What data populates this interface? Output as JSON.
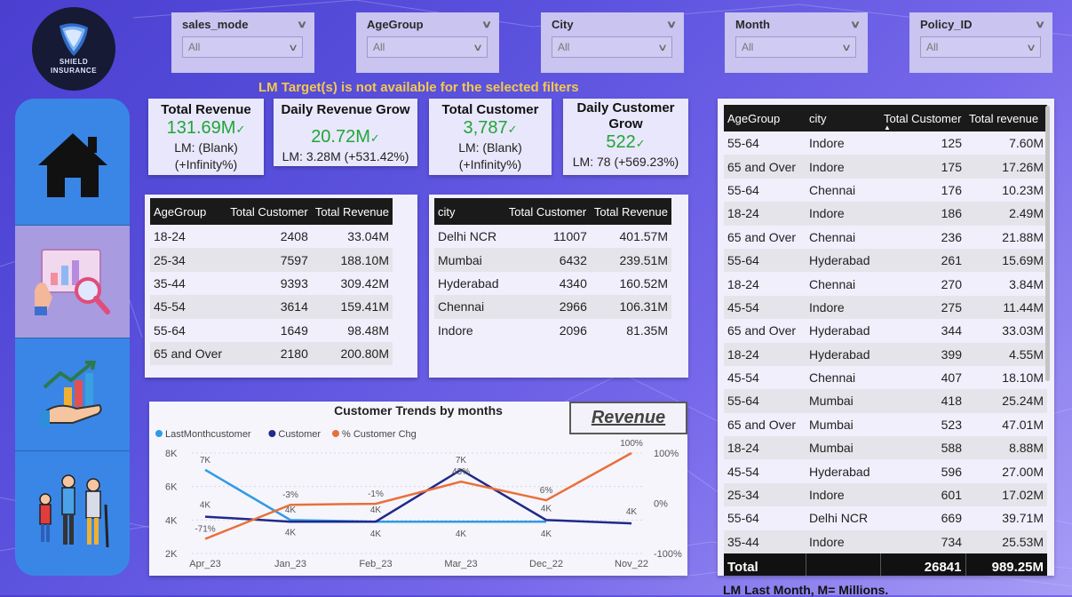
{
  "logo": {
    "name_line1": "SHIELD",
    "name_line2": "INSURANCE"
  },
  "nav": [
    {
      "name": "home-icon"
    },
    {
      "name": "analysis-icon"
    },
    {
      "name": "growth-icon"
    },
    {
      "name": "age-group-icon"
    }
  ],
  "slicers": [
    {
      "title": "sales_mode",
      "value": "All"
    },
    {
      "title": "AgeGroup",
      "value": "All"
    },
    {
      "title": "City",
      "value": "All"
    },
    {
      "title": "Month",
      "value": "All"
    },
    {
      "title": "Policy_ID",
      "value": "All"
    }
  ],
  "banner": "LM Target(s) is not available for the selected filters",
  "kpis": [
    {
      "title": "Total Revenue",
      "value": "131.69M",
      "lm": "LM: (Blank)",
      "chg": "(+Infinity%)"
    },
    {
      "title": "Daily Revenue Grow",
      "value": "20.72M",
      "lm": "LM: 3.28M (+531.42%)"
    },
    {
      "title": "Total Customer",
      "value": "3,787",
      "lm": "LM: (Blank)",
      "chg": "(+Infinity%)"
    },
    {
      "title1": "Daily Customer",
      "title2": "Grow",
      "value": "522",
      "lm": "LM: 78 (+569.23%)"
    }
  ],
  "age_table": {
    "headers": [
      "AgeGroup",
      "Total Customer",
      "Total Revenue"
    ],
    "rows": [
      [
        "18-24",
        "2408",
        "33.04M"
      ],
      [
        "25-34",
        "7597",
        "188.10M"
      ],
      [
        "35-44",
        "9393",
        "309.42M"
      ],
      [
        "45-54",
        "3614",
        "159.41M"
      ],
      [
        "55-64",
        "1649",
        "98.48M"
      ],
      [
        "65 and Over",
        "2180",
        "200.80M"
      ]
    ]
  },
  "city_table": {
    "headers": [
      "city",
      "Total Customer",
      "Total Revenue"
    ],
    "rows": [
      [
        "Delhi NCR",
        "11007",
        "401.57M"
      ],
      [
        "Mumbai",
        "6432",
        "239.51M"
      ],
      [
        "Hyderabad",
        "4340",
        "160.52M"
      ],
      [
        "Chennai",
        "2966",
        "106.31M"
      ],
      [
        "Indore",
        "2096",
        "81.35M"
      ]
    ]
  },
  "detail_table": {
    "headers": [
      "AgeGroup",
      "city",
      "Total Customer",
      "Total revenue"
    ],
    "rows": [
      [
        "55-64",
        "Indore",
        "125",
        "7.60M"
      ],
      [
        "65 and Over",
        "Indore",
        "175",
        "17.26M"
      ],
      [
        "55-64",
        "Chennai",
        "176",
        "10.23M"
      ],
      [
        "18-24",
        "Indore",
        "186",
        "2.49M"
      ],
      [
        "65 and Over",
        "Chennai",
        "236",
        "21.88M"
      ],
      [
        "55-64",
        "Hyderabad",
        "261",
        "15.69M"
      ],
      [
        "18-24",
        "Chennai",
        "270",
        "3.84M"
      ],
      [
        "45-54",
        "Indore",
        "275",
        "11.44M"
      ],
      [
        "65 and Over",
        "Hyderabad",
        "344",
        "33.03M"
      ],
      [
        "18-24",
        "Hyderabad",
        "399",
        "4.55M"
      ],
      [
        "45-54",
        "Chennai",
        "407",
        "18.10M"
      ],
      [
        "55-64",
        "Mumbai",
        "418",
        "25.24M"
      ],
      [
        "65 and Over",
        "Mumbai",
        "523",
        "47.01M"
      ],
      [
        "18-24",
        "Mumbai",
        "588",
        "8.88M"
      ],
      [
        "45-54",
        "Hyderabad",
        "596",
        "27.00M"
      ],
      [
        "25-34",
        "Indore",
        "601",
        "17.02M"
      ],
      [
        "55-64",
        "Delhi NCR",
        "669",
        "39.71M"
      ],
      [
        "35-44",
        "Indore",
        "734",
        "25.53M"
      ]
    ],
    "total": [
      "Total",
      "",
      "26841",
      "989.25M"
    ]
  },
  "revenue_button": "Revenue",
  "footnote": "LM Last Month, M= Millions.",
  "chart_data": {
    "type": "line",
    "title": "Customer Trends by months",
    "categories": [
      "Apr_23",
      "Jan_23",
      "Feb_23",
      "Mar_23",
      "Dec_22",
      "Nov_22"
    ],
    "y_left": {
      "ticks": [
        "2K",
        "4K",
        "6K",
        "8K"
      ],
      "min": 2000,
      "max": 8000
    },
    "y_right": {
      "ticks": [
        "-100%",
        "0%",
        "100%"
      ],
      "min": -100,
      "max": 100
    },
    "series": [
      {
        "name": "LastMonthcustomer",
        "color": "#2e9be6",
        "axis": "left",
        "values": [
          7000,
          4000,
          3900,
          3900,
          3900,
          null
        ],
        "labels": [
          "7K",
          "4K",
          "4K",
          "4K",
          "4K",
          ""
        ]
      },
      {
        "name": "Customer",
        "color": "#1f2a8a",
        "axis": "left",
        "values": [
          4200,
          3900,
          3900,
          7000,
          4000,
          3800
        ],
        "labels": [
          "4K",
          "4K",
          "4K",
          "7K",
          "4K",
          "4K"
        ]
      },
      {
        "name": "% Customer Chg",
        "color": "#e8703a",
        "axis": "right",
        "values": [
          -71,
          -3,
          -1,
          43,
          6,
          100
        ],
        "labels": [
          "-71%",
          "-3%",
          "-1%",
          "43%",
          "6%",
          "100%"
        ]
      }
    ]
  }
}
